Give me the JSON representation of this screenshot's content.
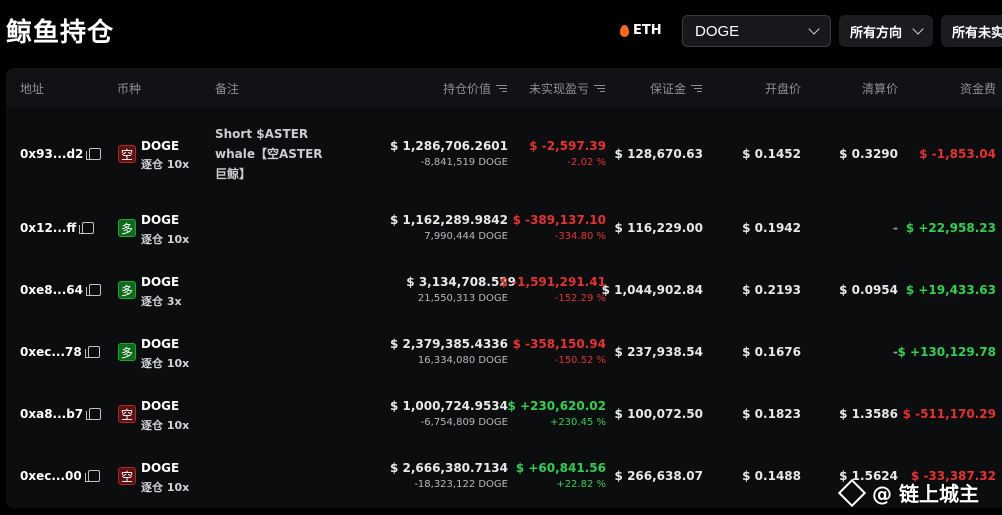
{
  "page_title": "鲸鱼持仓",
  "filters": {
    "chain_label": "ETH",
    "coin_selected": "DOGE",
    "direction_label": "所有方向",
    "unrealized_label": "所有未实"
  },
  "columns": {
    "address": "地址",
    "coin": "币种",
    "note": "备注",
    "position_value": "持仓价值",
    "unrealized_pnl": "未实现盈亏",
    "margin": "保证金",
    "entry_price": "开盘价",
    "liq_price": "清算价",
    "funding": "资金费"
  },
  "rows": [
    {
      "address": "0x93...d2",
      "side": "空",
      "side_type": "short",
      "coin": "DOGE",
      "leverage": "逐仓 10x",
      "note": "Short $ASTER whale【空ASTER巨鲸】",
      "value": "$ 1,286,706.2601",
      "size": "-8,841,519 DOGE",
      "pnl": "$ -2,597.39",
      "pnl_pct": "-2.02 %",
      "pnl_type": "red",
      "margin": "$ 128,670.63",
      "entry": "$ 0.1452",
      "liq": "$ 0.3290",
      "funding": "$ -1,853.04",
      "funding_type": "red"
    },
    {
      "address": "0x12...ff",
      "side": "多",
      "side_type": "long",
      "coin": "DOGE",
      "leverage": "逐仓 10x",
      "note": "",
      "value": "$ 1,162,289.9842",
      "size": "7,990,444 DOGE",
      "pnl": "$ -389,137.10",
      "pnl_pct": "-334.80 %",
      "pnl_type": "red",
      "margin": "$ 116,229.00",
      "entry": "$ 0.1942",
      "liq": "-",
      "funding": "$ +22,958.23",
      "funding_type": "green"
    },
    {
      "address": "0xe8...64",
      "side": "多",
      "side_type": "long",
      "coin": "DOGE",
      "leverage": "逐仓 3x",
      "note": "",
      "value": "$ 3,134,708.529",
      "size": "21,550,313 DOGE",
      "pnl": "$ -1,591,291.41",
      "pnl_pct": "-152.29 %",
      "pnl_type": "red",
      "margin": "$ 1,044,902.84",
      "entry": "$ 0.2193",
      "liq": "$ 0.0954",
      "funding": "$ +19,433.63",
      "funding_type": "green"
    },
    {
      "address": "0xec...78",
      "side": "多",
      "side_type": "long",
      "coin": "DOGE",
      "leverage": "逐仓 10x",
      "note": "",
      "value": "$ 2,379,385.4336",
      "size": "16,334,080 DOGE",
      "pnl": "$ -358,150.94",
      "pnl_pct": "-150.52 %",
      "pnl_type": "red",
      "margin": "$ 237,938.54",
      "entry": "$ 0.1676",
      "liq": "-",
      "funding": "$ +130,129.78",
      "funding_type": "green"
    },
    {
      "address": "0xa8...b7",
      "side": "空",
      "side_type": "short",
      "coin": "DOGE",
      "leverage": "逐仓 10x",
      "note": "",
      "value": "$ 1,000,724.9534",
      "size": "-6,754,809 DOGE",
      "pnl": "$ +230,620.02",
      "pnl_pct": "+230.45 %",
      "pnl_type": "green",
      "margin": "$ 100,072.50",
      "entry": "$ 0.1823",
      "liq": "$ 1.3586",
      "funding": "$ -511,170.29",
      "funding_type": "red"
    },
    {
      "address": "0xec...00",
      "side": "空",
      "side_type": "short",
      "coin": "DOGE",
      "leverage": "逐仓 10x",
      "note": "",
      "value": "$ 2,666,380.7134",
      "size": "-18,323,122 DOGE",
      "pnl": "$ +60,841.56",
      "pnl_pct": "+22.82 %",
      "pnl_type": "green",
      "margin": "$ 266,638.07",
      "entry": "$ 0.1488",
      "liq": "$ 1.5624",
      "funding": "$ -33,387.32",
      "funding_type": "red"
    }
  ],
  "watermark": "@ 链上城主",
  "colors": {
    "red": "#e5322f",
    "green": "#2fd052",
    "background": "#000000"
  }
}
